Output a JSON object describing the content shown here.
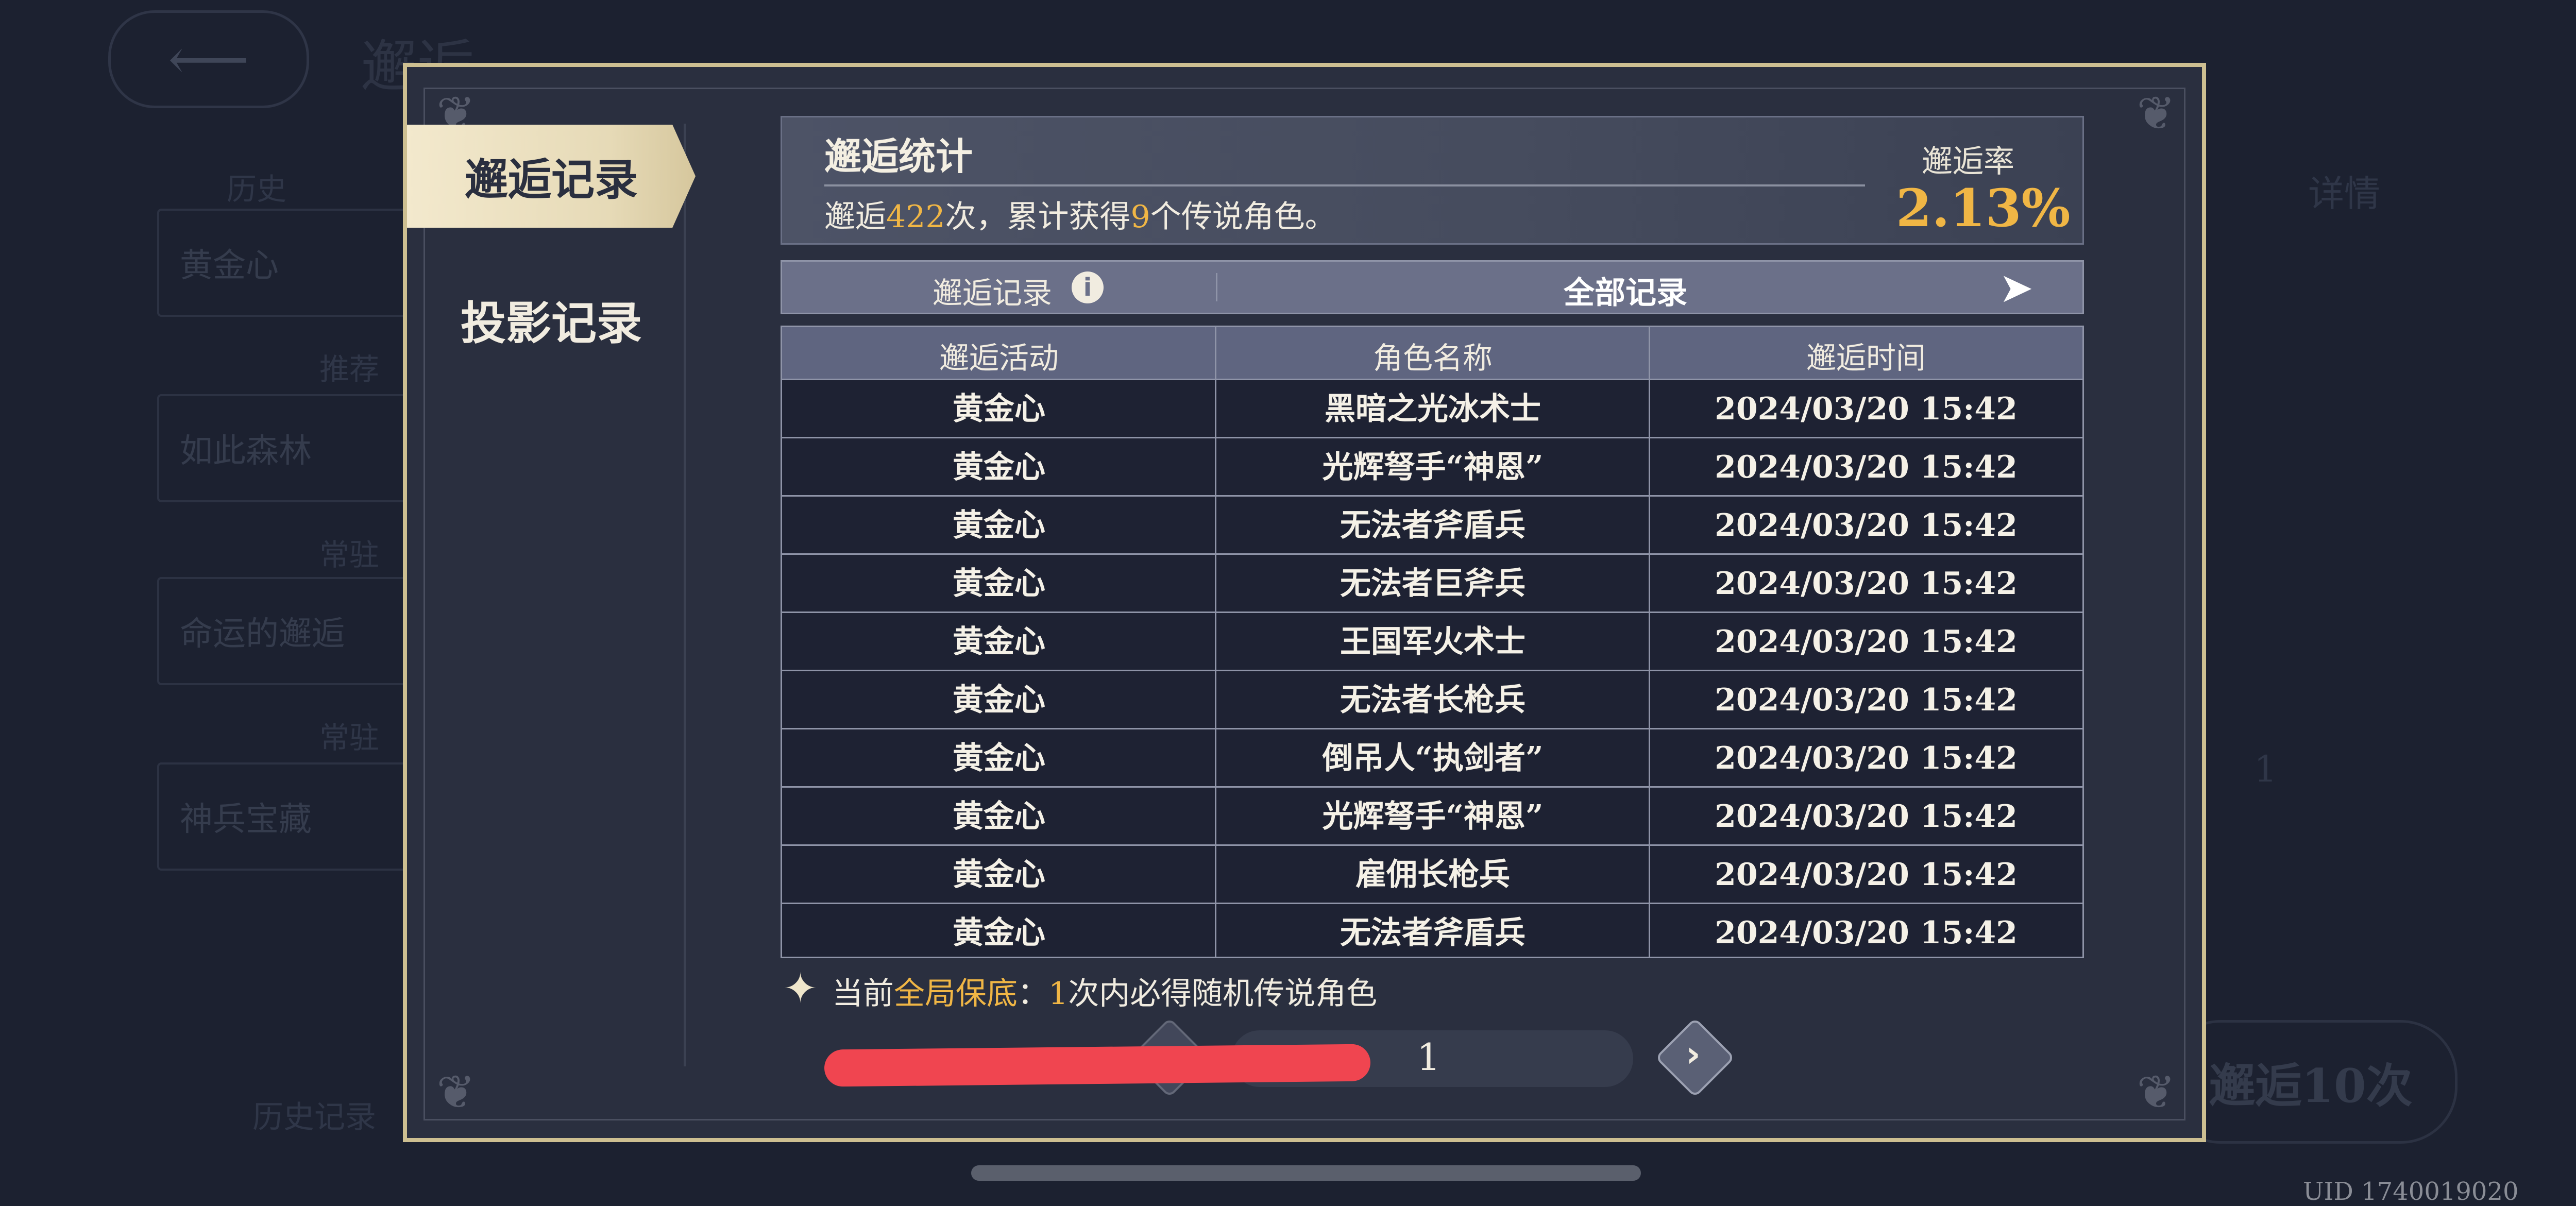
{
  "background": {
    "title": "邂逅",
    "left_items": [
      "黄金心",
      "如此森林",
      "命运的邂逅",
      "神兵宝藏"
    ],
    "left_headers": [
      "历史",
      "推荐",
      "常驻",
      "常驻"
    ],
    "right_detail_label": "详情",
    "pull_ten_label": "邂逅10次",
    "history_label": "历史记录",
    "uid": "UID 1740019020",
    "top_counter": "1"
  },
  "sidebar": {
    "tabs": [
      {
        "label": "邂逅记录",
        "active": true
      },
      {
        "label": "投影记录",
        "active": false
      }
    ]
  },
  "stats": {
    "title": "邂逅统计",
    "summary_prefix": "邂逅",
    "total_pulls": "422",
    "summary_mid": "次，累计获得",
    "legend_count": "9",
    "summary_suffix": "个传说角色。",
    "rate_label": "邂逅率",
    "rate_value": "2.13%"
  },
  "filter": {
    "label": "邂逅记录",
    "info_icon": "i",
    "value": "全部记录",
    "arrow": "➤"
  },
  "table": {
    "columns": [
      "邂逅活动",
      "角色名称",
      "邂逅时间"
    ],
    "rows": [
      [
        "黄金心",
        "黑暗之光冰术士",
        "2024/03/20 15:42"
      ],
      [
        "黄金心",
        "光辉弩手“神恩”",
        "2024/03/20 15:42"
      ],
      [
        "黄金心",
        "无法者斧盾兵",
        "2024/03/20 15:42"
      ],
      [
        "黄金心",
        "无法者巨斧兵",
        "2024/03/20 15:42"
      ],
      [
        "黄金心",
        "王国军火术士",
        "2024/03/20 15:42"
      ],
      [
        "黄金心",
        "无法者长枪兵",
        "2024/03/20 15:42"
      ],
      [
        "黄金心",
        "倒吊人“执剑者”",
        "2024/03/20 15:42"
      ],
      [
        "黄金心",
        "光辉弩手“神恩”",
        "2024/03/20 15:42"
      ],
      [
        "黄金心",
        "雇佣长枪兵",
        "2024/03/20 15:42"
      ],
      [
        "黄金心",
        "无法者斧盾兵",
        "2024/03/20 15:42"
      ]
    ]
  },
  "guarantee": {
    "prefix": "当前",
    "highlight": "全局保底",
    "colon": "：",
    "count": "1",
    "suffix": "次内必得随机传说角色"
  },
  "pagination": {
    "current_page": "1",
    "prev_glyph": "‹",
    "next_glyph": "›"
  },
  "colors": {
    "accent_gold": "#f0b645",
    "frame_gold": "#cdbf91",
    "redaction": "#f04550"
  }
}
